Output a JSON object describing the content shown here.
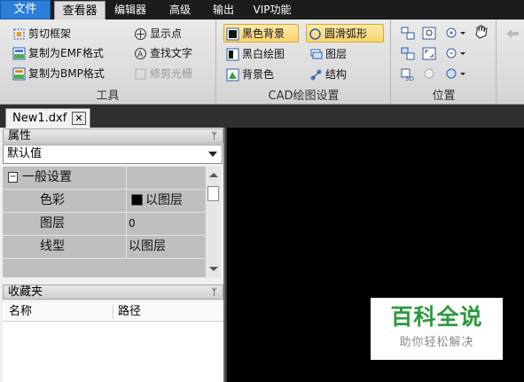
{
  "menu": {
    "file": "文件",
    "tabs": [
      "查看器",
      "编辑器",
      "高级",
      "输出",
      "VIP功能"
    ]
  },
  "ribbon": {
    "tools": {
      "title": "工具",
      "crop_frame": "剪切框架",
      "copy_emf": "复制为EMF格式",
      "copy_bmp": "复制为BMP格式",
      "show_points": "显示点",
      "find_text": "查找文字",
      "trim_raster": "修剪光栅"
    },
    "cad_settings": {
      "title": "CAD绘图设置",
      "black_bg": "黑色背景",
      "bw_drawing": "黑白绘图",
      "bg_color": "背景色",
      "smooth_arc": "圆滑弧形",
      "layers": "图层",
      "structure": "结构"
    },
    "position": {
      "title": "位置"
    }
  },
  "document_tab": {
    "name": "New1.dxf",
    "close": "✕"
  },
  "properties": {
    "title": "属性",
    "pin": "ᛘ",
    "dropdown_value": "默认值",
    "section": "一般设置",
    "rows": [
      {
        "key": "色彩",
        "value": "以图层"
      },
      {
        "key": "图层",
        "value": "0"
      },
      {
        "key": "线型",
        "value": "以图层"
      }
    ]
  },
  "favorites": {
    "title": "收藏夹",
    "pin": "ᛘ",
    "col_name": "名称",
    "col_path": "路径"
  },
  "watermark": {
    "line1": "百科全说",
    "line2": "助你轻松解决"
  },
  "colors": {
    "accent": "#2c7fd9",
    "selected": "#f8d472",
    "canvas": "#000000",
    "watermark": "#2a9a3c"
  }
}
